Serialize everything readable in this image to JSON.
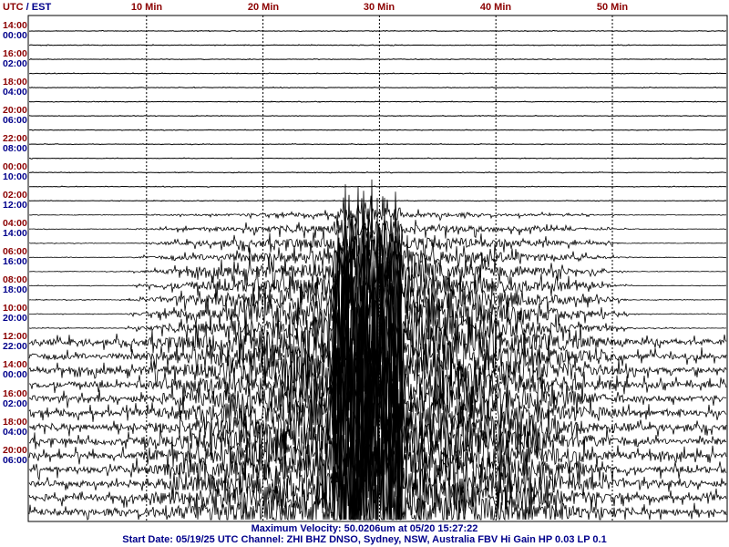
{
  "colors": {
    "utc": "#8b0000",
    "local": "#00008b",
    "trace": "#000000",
    "grid": "#000000",
    "footer": "#00008b",
    "tick_label": "#8b0000"
  },
  "header": {
    "utc": "UTC",
    "sep": " / ",
    "local": "EST"
  },
  "chart_data": {
    "type": "line",
    "title": "",
    "x_unit": "Min",
    "x_range": [
      0,
      60
    ],
    "x_ticks": [
      {
        "value": 10,
        "label": "10 Min"
      },
      {
        "value": 20,
        "label": "20 Min"
      },
      {
        "value": 30,
        "label": "30 Min"
      },
      {
        "value": 40,
        "label": "40 Min"
      },
      {
        "value": 50,
        "label": "50 Min"
      }
    ],
    "grid": "vertical dashed at tick minutes",
    "row_count": 35,
    "hours_per_row": 1,
    "row_labels": [
      {
        "utc": "14:00",
        "local": "00:00"
      },
      {
        "utc": "16:00",
        "local": "02:00"
      },
      {
        "utc": "18:00",
        "local": "04:00"
      },
      {
        "utc": "20:00",
        "local": "06:00"
      },
      {
        "utc": "22:00",
        "local": "08:00"
      },
      {
        "utc": "00:00",
        "local": "10:00"
      },
      {
        "utc": "02:00",
        "local": "12:00"
      },
      {
        "utc": "04:00",
        "local": "14:00"
      },
      {
        "utc": "06:00",
        "local": "16:00"
      },
      {
        "utc": "08:00",
        "local": "18:00"
      },
      {
        "utc": "10:00",
        "local": "20:00"
      },
      {
        "utc": "12:00",
        "local": "22:00"
      },
      {
        "utc": "14:00",
        "local": "00:00"
      },
      {
        "utc": "16:00",
        "local": "02:00"
      },
      {
        "utc": "18:00",
        "local": "04:00"
      },
      {
        "utc": "20:00",
        "local": "06:00"
      }
    ],
    "activity_profile": [
      {
        "row": 0,
        "level": "quiet"
      },
      {
        "row": 10,
        "level": "quiet"
      },
      {
        "row": 13,
        "level": "event begins ~24 Min"
      },
      {
        "row": 16,
        "level": "moderate"
      },
      {
        "row": 20,
        "level": "high"
      },
      {
        "row": 24,
        "level": "very high"
      },
      {
        "row": 34,
        "level": "very high"
      }
    ],
    "event_peak_minute": 30
  },
  "footer": {
    "line1": "Maximum Velocity: 50.0206um at 05/20 15:27:22",
    "line2": "Start Date: 05/19/25 UTC Channel: ZHI  BHZ  DNSO, Sydney, NSW, Australia  FBV Hi Gain HP 0.03  LP 0.1"
  }
}
